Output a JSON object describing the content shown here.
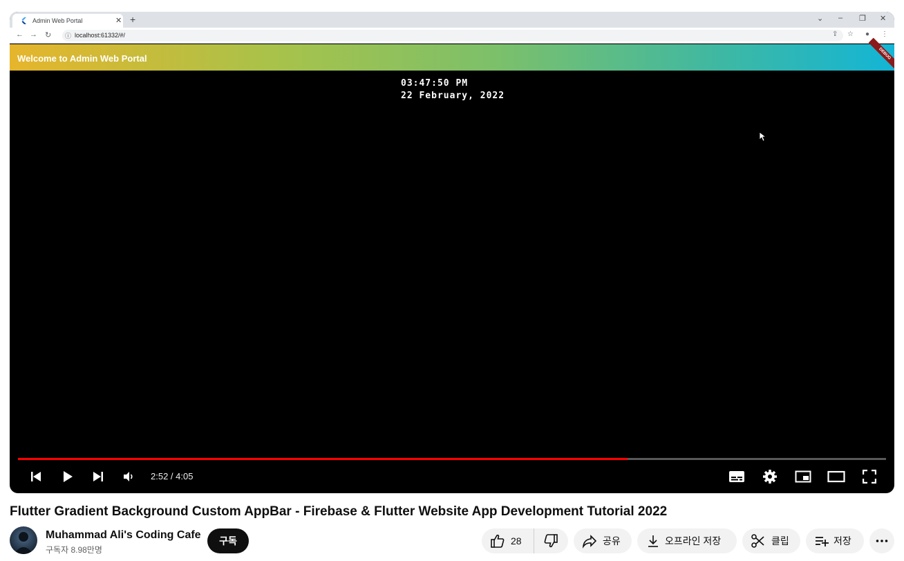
{
  "browser": {
    "tab_title": "Admin Web Portal",
    "tab_close": "✕",
    "new_tab": "+",
    "url": "localhost:61332/#/",
    "window_controls": [
      "⌄",
      "–",
      "❐",
      "✕"
    ]
  },
  "app": {
    "appbar_title": "Welcome to Admin Web Portal",
    "debug_label": "DEBUG",
    "clock_time": "03:47:50 PM",
    "clock_date": "22 February, 2022",
    "gradient_colors": [
      "#e6b52c",
      "#13b5d6"
    ]
  },
  "player": {
    "time_display": "2:52 / 4:05",
    "progress": 0.702,
    "progress_color": "#ff0000",
    "controls": [
      "previous-icon",
      "play-icon",
      "next-icon",
      "volume-icon",
      "subtitles-icon",
      "settings-icon",
      "miniplayer-icon",
      "theater-icon",
      "fullscreen-icon"
    ]
  },
  "video": {
    "title": "Flutter Gradient Background Custom AppBar - Firebase & Flutter Website App Development Tutorial 2022",
    "channel_name": "Muhammad Ali's Coding Cafe",
    "subscribers": "구독자 8.98만명",
    "subscribe_label": "구독",
    "likes": "28",
    "share_label": "공유",
    "download_label": "오프라인 저장",
    "clip_label": "클립",
    "save_label": "저장",
    "more_icon": "more-icon"
  }
}
